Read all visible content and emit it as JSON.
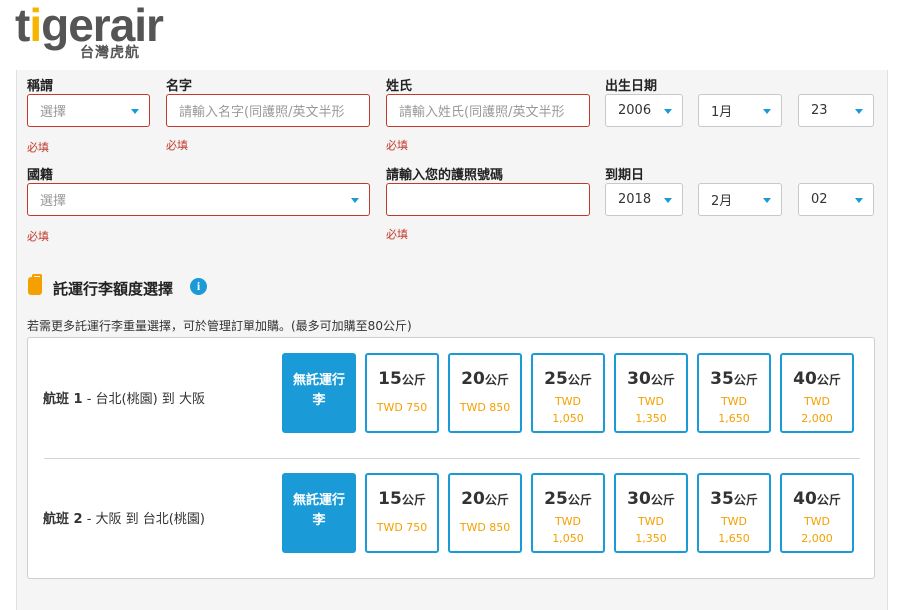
{
  "logo": {
    "word_a": "t",
    "word_b": "i",
    "word_c": "gerair",
    "sub": "台灣虎航"
  },
  "passenger": {
    "title": {
      "label": "稱謂",
      "value": "選擇",
      "req": "必填"
    },
    "first_name": {
      "label": "名字",
      "placeholder": "請輸入名字(同護照/英文半形",
      "req": "必填"
    },
    "last_name": {
      "label": "姓氏",
      "placeholder": "請輸入姓氏(同護照/英文半形",
      "req": "必填"
    },
    "dob": {
      "label": "出生日期",
      "year": "2006",
      "month": "1月",
      "day": "23"
    },
    "nationality": {
      "label": "國籍",
      "value": "選擇",
      "req": "必填"
    },
    "passport": {
      "label": "請輸入您的護照號碼",
      "value": "",
      "req": "必填"
    },
    "expiry": {
      "label": "到期日",
      "year": "2018",
      "month": "2月",
      "day": "02"
    }
  },
  "baggage": {
    "title": "託運行李額度選擇",
    "info_icon": "i",
    "note": "若需更多託運行李重量選擇，可於管理訂單加購。(最多可加購至80公斤)",
    "no_bag_label": "無託運行李",
    "unit": "公斤",
    "flights": [
      {
        "label_bold": "航班 1",
        "label_rest": " - 台北(桃園) 到 大阪"
      },
      {
        "label_bold": "航班 2",
        "label_rest": " - 大阪 到 台北(桃園)"
      }
    ],
    "options": [
      {
        "kg": "15",
        "price1": "TWD 750",
        "price2": ""
      },
      {
        "kg": "20",
        "price1": "TWD 850",
        "price2": ""
      },
      {
        "kg": "25",
        "price1": "TWD",
        "price2": "1,050"
      },
      {
        "kg": "30",
        "price1": "TWD",
        "price2": "1,350"
      },
      {
        "kg": "35",
        "price1": "TWD",
        "price2": "1,650"
      },
      {
        "kg": "40",
        "price1": "TWD",
        "price2": "2,000"
      }
    ]
  }
}
